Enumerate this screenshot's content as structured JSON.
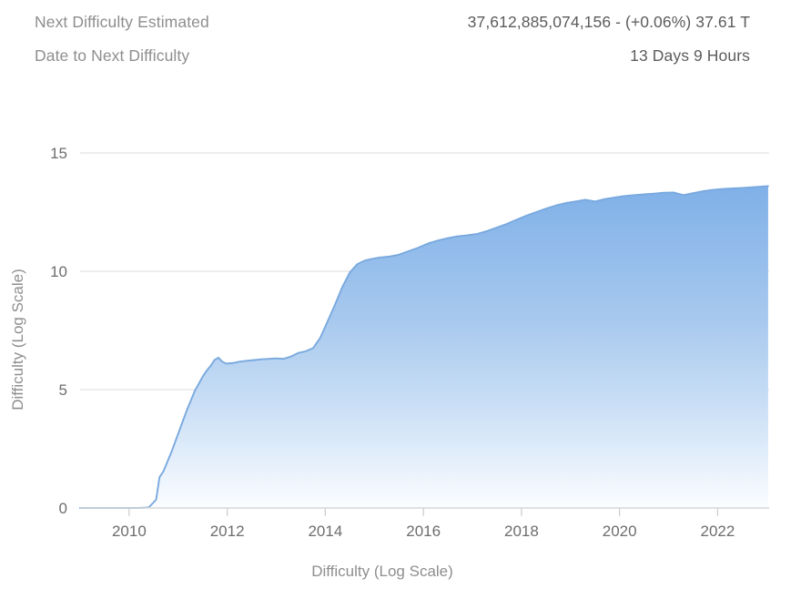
{
  "stats": [
    {
      "label": "Next Difficulty Estimated",
      "value": "37,612,885,074,156 - (+0.06%) 37.61 T"
    },
    {
      "label": "Date to Next Difficulty",
      "value": "13 Days 9 Hours"
    }
  ],
  "colors": {
    "label_text": "#8e8e8e",
    "value_text": "#5c5c5c",
    "line": "#79a9de",
    "fill_top": "#7fb0e8",
    "fill_bottom": "#f7fafe",
    "gridline": "#e2e2e2",
    "axis": "#d8d8d8"
  },
  "chart_data": {
    "type": "area",
    "title": "",
    "xlabel": "Difficulty (Log Scale)",
    "ylabel": "Difficulty (Log Scale)",
    "xlim": [
      2009.0,
      2023.05
    ],
    "ylim": [
      0,
      16.1
    ],
    "grid": true,
    "legend": null,
    "y_ticks": [
      0,
      5,
      10,
      15
    ],
    "y_tick_labels": [
      "0",
      "5",
      "10",
      "15"
    ],
    "x_ticks": [
      2010,
      2012,
      2014,
      2016,
      2018,
      2020,
      2022
    ],
    "x_tick_labels": [
      "2010",
      "2012",
      "2014",
      "2016",
      "2018",
      "2020",
      "2022"
    ],
    "series": [
      {
        "name": "Difficulty (Log Scale)",
        "x": [
          2009.0,
          2009.2,
          2009.4,
          2009.6,
          2009.8,
          2010.0,
          2010.2,
          2010.4,
          2010.55,
          2010.62,
          2010.7,
          2010.78,
          2010.86,
          2010.94,
          2011.02,
          2011.1,
          2011.18,
          2011.26,
          2011.34,
          2011.42,
          2011.5,
          2011.58,
          2011.66,
          2011.74,
          2011.82,
          2011.9,
          2011.98,
          2012.1,
          2012.25,
          2012.4,
          2012.55,
          2012.7,
          2012.85,
          2013.0,
          2013.15,
          2013.3,
          2013.45,
          2013.6,
          2013.75,
          2013.9,
          2014.05,
          2014.2,
          2014.35,
          2014.5,
          2014.65,
          2014.8,
          2014.95,
          2015.1,
          2015.3,
          2015.5,
          2015.7,
          2015.9,
          2016.1,
          2016.3,
          2016.5,
          2016.7,
          2016.9,
          2017.1,
          2017.3,
          2017.5,
          2017.7,
          2017.9,
          2018.1,
          2018.3,
          2018.5,
          2018.7,
          2018.9,
          2019.1,
          2019.3,
          2019.5,
          2019.7,
          2019.9,
          2020.1,
          2020.3,
          2020.5,
          2020.7,
          2020.9,
          2021.1,
          2021.3,
          2021.5,
          2021.7,
          2021.9,
          2022.1,
          2022.3,
          2022.5,
          2022.7,
          2022.9,
          2023.03
        ],
        "y": [
          0.0,
          0.0,
          0.0,
          0.0,
          0.0,
          0.0,
          0.0,
          0.02,
          0.35,
          1.3,
          1.55,
          1.95,
          2.35,
          2.8,
          3.25,
          3.7,
          4.15,
          4.55,
          4.95,
          5.25,
          5.55,
          5.8,
          6.0,
          6.25,
          6.35,
          6.18,
          6.1,
          6.12,
          6.18,
          6.22,
          6.25,
          6.28,
          6.3,
          6.32,
          6.3,
          6.4,
          6.55,
          6.62,
          6.75,
          7.2,
          7.9,
          8.6,
          9.35,
          9.95,
          10.3,
          10.45,
          10.52,
          10.58,
          10.62,
          10.7,
          10.85,
          11.0,
          11.18,
          11.3,
          11.4,
          11.48,
          11.52,
          11.58,
          11.7,
          11.85,
          12.0,
          12.18,
          12.35,
          12.5,
          12.65,
          12.78,
          12.88,
          12.95,
          13.02,
          12.95,
          13.05,
          13.12,
          13.18,
          13.22,
          13.25,
          13.28,
          13.32,
          13.33,
          13.22,
          13.3,
          13.38,
          13.44,
          13.48,
          13.5,
          13.52,
          13.55,
          13.58,
          13.6
        ]
      }
    ]
  }
}
